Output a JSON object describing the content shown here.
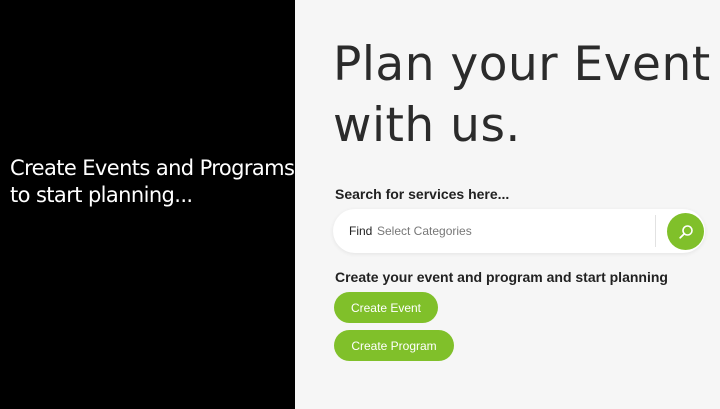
{
  "left_panel": {
    "line1": "Create Events and Programs",
    "line2": "to start planning..."
  },
  "hero": {
    "line1": "Plan your Event",
    "line2": "with us."
  },
  "search": {
    "heading": "Search for services here...",
    "find_label": "Find",
    "placeholder": "Select Categories",
    "button_icon": "search-icon"
  },
  "create": {
    "heading": "Create your event and program and start planning",
    "event_button": "Create Event",
    "program_button": "Create Program"
  },
  "colors": {
    "accent": "#80c02a",
    "left_bg": "#000000",
    "right_bg": "#f6f6f6"
  }
}
